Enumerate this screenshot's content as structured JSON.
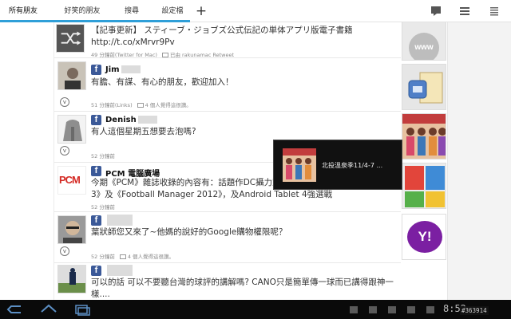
{
  "tabs": [
    {
      "label": "所有朋友"
    },
    {
      "label": "好笑的朋友"
    },
    {
      "label": "搜尋"
    },
    {
      "label": "設定檔"
    }
  ],
  "top_icons": [
    "compose-icon",
    "filter-icon",
    "overflow-menu-icon"
  ],
  "feed": {
    "posts": [
      {
        "text": "【記事更新】 スティーブ・ジョブズ公式伝記の単体アプリ版電子書籍 http://t.co/xMrvr9Pv",
        "meta_time": "49 分鐘前(Twitter for Mac)",
        "meta_extra": "已由 rakunamac Retweet",
        "thumb_label": "www"
      },
      {
        "name": "Jim",
        "text": "有膽、有謀、有心的朋友，歡迎加入！",
        "meta_time": "51 分鐘前(Links)",
        "meta_extra": "4 個人覺得這很讚。"
      },
      {
        "name": "Denish",
        "text": "有人這個星期五想要去泡嗎?",
        "meta_time": "52 分鐘前"
      },
      {
        "name": "PCM 電腦廣場",
        "text": "今期《PCM》雜誌收錄的內容有：話題作DC攝力對決，最火熱遊戲雙打《Battlefield 3》及《Football Manager 2012》，及Android Tablet 4強選戰",
        "meta_time": "52 分鐘前",
        "avatar_text": "PCM"
      },
      {
        "text": "葉狀師您又來了~他媽的說好的Google購物權限呢？",
        "meta_time": "52 分鐘前",
        "meta_extra": "4 個人覺得這很讚。",
        "thumb_label": "Y!"
      },
      {
        "text": "可以的話 可以不要聽台灣的球評的講解嗎? CANO只是簡單傳一球而已講得跟神一樣...."
      }
    ]
  },
  "toast": {
    "text": "北投溫泉季11/4-7 ..."
  },
  "status_bar": {
    "clock": "8:52",
    "watermark": "#363914"
  }
}
